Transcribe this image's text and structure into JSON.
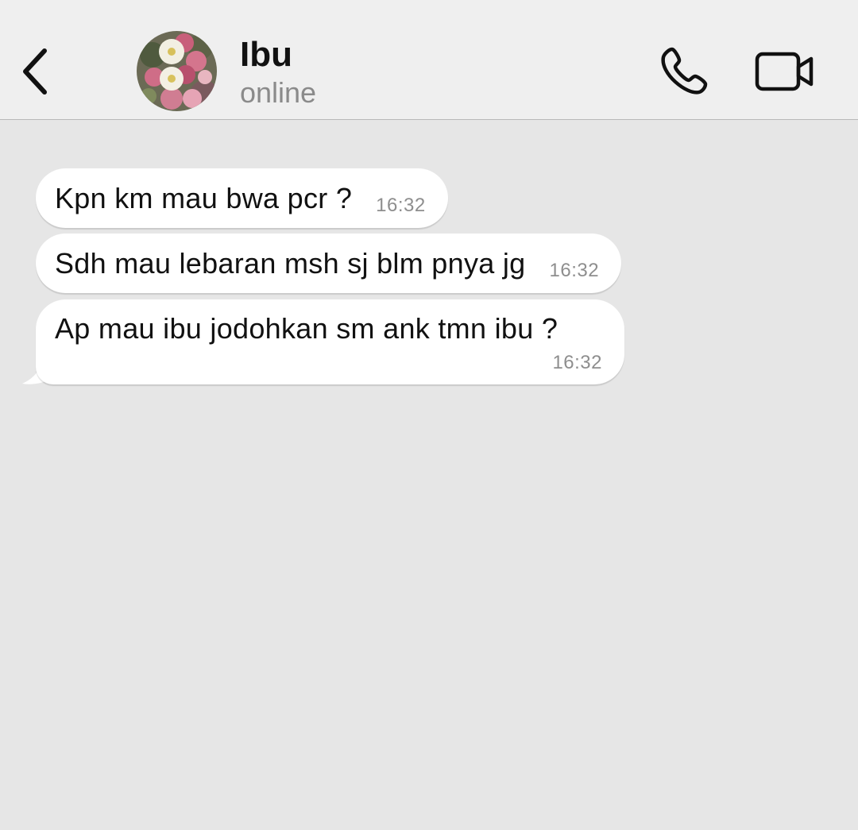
{
  "header": {
    "contact_name": "Ibu",
    "status": "online",
    "icons": {
      "back": "chevron-left-icon",
      "call": "phone-icon",
      "video": "video-camera-icon"
    }
  },
  "messages": [
    {
      "text": "Kpn km mau bwa pcr ?",
      "time": "16:32",
      "direction": "incoming"
    },
    {
      "text": "Sdh mau lebaran msh sj blm pnya jg",
      "time": "16:32",
      "direction": "incoming"
    },
    {
      "text": "Ap mau ibu jodohkan sm ank tmn ibu ?",
      "time": "16:32",
      "direction": "incoming"
    }
  ],
  "colors": {
    "header_bg": "#efefef",
    "chat_bg": "#e6e6e6",
    "bubble_bg": "#ffffff",
    "status_text": "#8a8a8a",
    "time_text": "#8e8e8e"
  }
}
